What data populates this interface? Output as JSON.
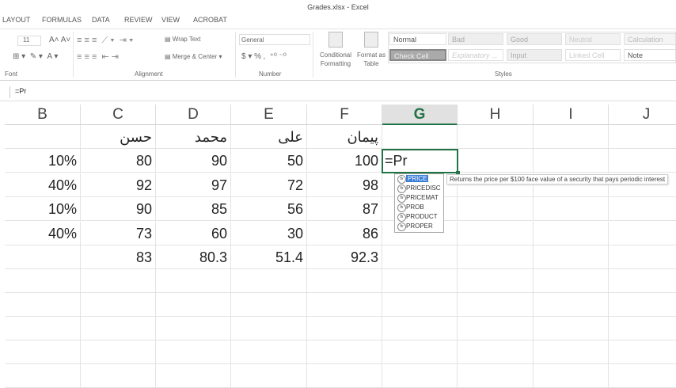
{
  "window": {
    "title": "Grades.xlsx - Excel"
  },
  "tabs": [
    "LAYOUT",
    "FORMULAS",
    "DATA",
    "REVIEW",
    "VIEW",
    "ACROBAT"
  ],
  "ribbon": {
    "font_size": "11",
    "wrap_text": "Wrap Text",
    "merge_center": "Merge & Center",
    "number_format": "General",
    "conditional_formatting": "Conditional Formatting",
    "format_as_table": "Format as Table",
    "groups": {
      "font": "Font",
      "alignment": "Alignment",
      "number": "Number",
      "styles": "Styles"
    },
    "styles": [
      "Normal",
      "Bad",
      "Good",
      "Neutral",
      "Calculation",
      "Check Cell",
      "Explanatory ...",
      "Input",
      "Linked Cell",
      "Note"
    ]
  },
  "formula_bar": {
    "value": "=Pr"
  },
  "columns": [
    "B",
    "C",
    "D",
    "E",
    "F",
    "G",
    "H",
    "I",
    "J"
  ],
  "active_column": "G",
  "rows": [
    [
      "",
      "حسن",
      "محمد",
      "علی",
      "پیمان"
    ],
    [
      "10%",
      "80",
      "90",
      "50",
      "100"
    ],
    [
      "40%",
      "92",
      "97",
      "72",
      "98"
    ],
    [
      "10%",
      "90",
      "85",
      "56",
      "87"
    ],
    [
      "40%",
      "73",
      "60",
      "30",
      "86"
    ],
    [
      "",
      "83",
      "80.3",
      "51.4",
      "92.3"
    ]
  ],
  "active_cell": {
    "ref": "G2",
    "value": "=Pr"
  },
  "autocomplete": {
    "items": [
      "PRICE",
      "PRICEDISC",
      "PRICEMAT",
      "PROB",
      "PRODUCT",
      "PROPER"
    ],
    "selected": "PRICE",
    "tooltip": "Returns the price per $100 face value of a security that pays periodic interest"
  },
  "colors": {
    "accent": "#217346",
    "selection": "#3c7fd8"
  }
}
